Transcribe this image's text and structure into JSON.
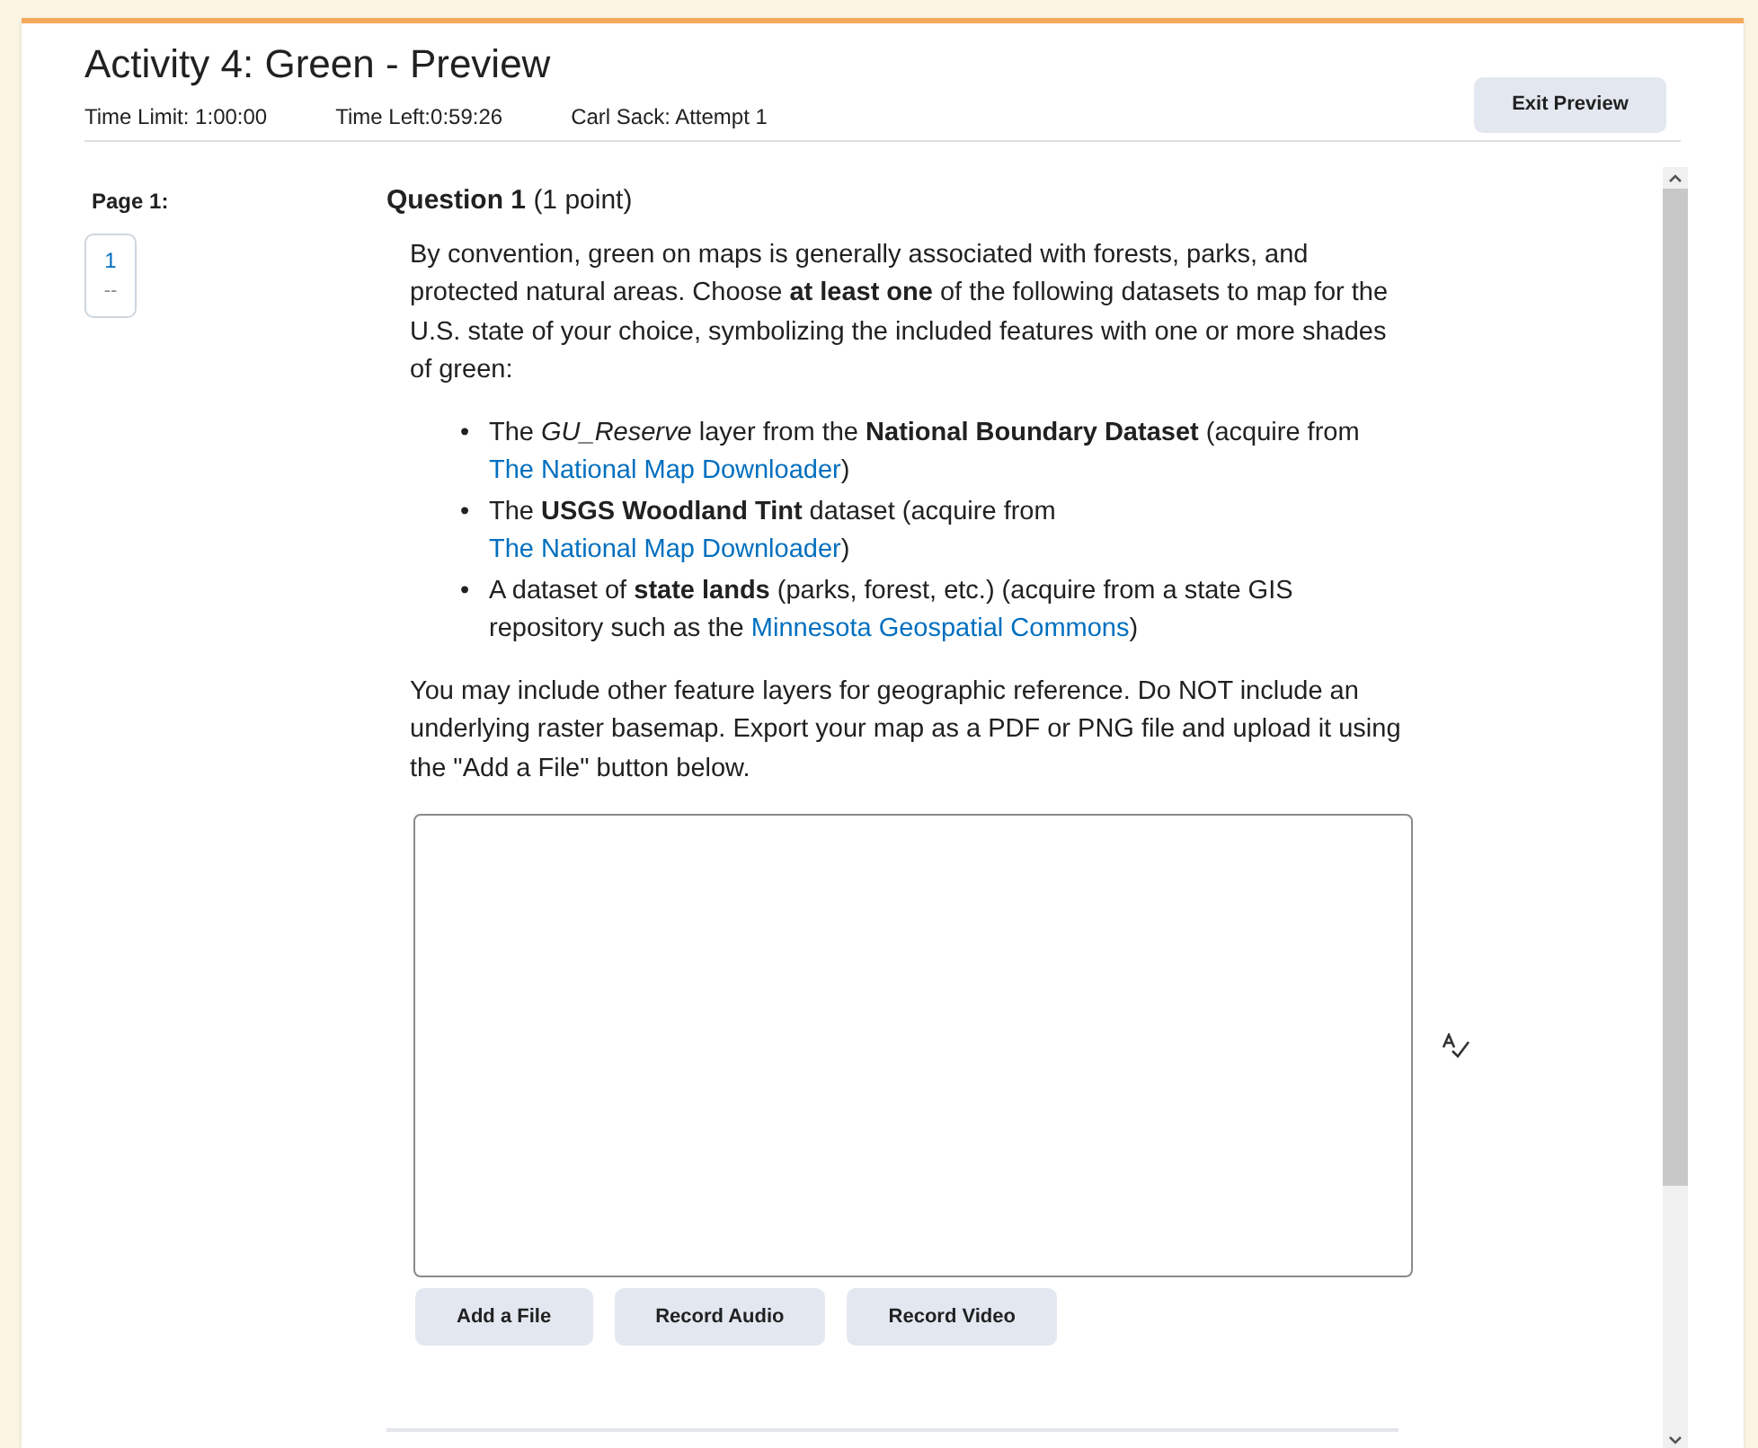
{
  "header": {
    "title": "Activity 4: Green - Preview",
    "info": [
      "Time Limit: 1:00:00",
      "Time Left:0:59:26",
      "Carl Sack: Attempt 1"
    ],
    "exit_button": "Exit Preview"
  },
  "page_nav": {
    "label": "Page 1:",
    "pages": [
      {
        "number": "1",
        "status": "--",
        "selected": false
      }
    ]
  },
  "question": {
    "title": "Question 1",
    "points": "(1 point)",
    "intro": "By convention, green on maps is generally associated with forests, parks, and protected natural areas. Choose **at least one** of the following datasets to map for the U.S. state of your choice, symbolizing the included features with one or more shades of green:",
    "bullets": [
      {
        "marker": "•",
        "segments": [
          {
            "kind": "text",
            "text": "The *GU_Reserve* layer from the **National Boundary Dataset** (acquire from "
          },
          {
            "kind": "link",
            "text": "The National Map Downloader"
          },
          {
            "kind": "text",
            "text": ")"
          }
        ]
      },
      {
        "marker": "•",
        "segments": [
          {
            "kind": "text",
            "text": "The **USGS Woodland Tint** dataset (acquire from "
          },
          {
            "kind": "link",
            "text": "The National Map Downloader"
          },
          {
            "kind": "text",
            "text": ")"
          }
        ]
      },
      {
        "marker": "•",
        "segments": [
          {
            "kind": "text",
            "text": "A dataset of **state lands** (parks, forest, etc.) (acquire from a state GIS repository such as the "
          },
          {
            "kind": "link",
            "text": "Minnesota Geospatial Commons"
          },
          {
            "kind": "text",
            "text": ")"
          }
        ]
      }
    ],
    "outro": "You may include other feature layers for geographic reference. Do NOT include an underlying raster basemap. Export your map as a PDF or PNG file and upload it using the \"Add a File\" button below.",
    "buttons": [
      "Add a File",
      "Record Audio",
      "Record Video"
    ]
  }
}
